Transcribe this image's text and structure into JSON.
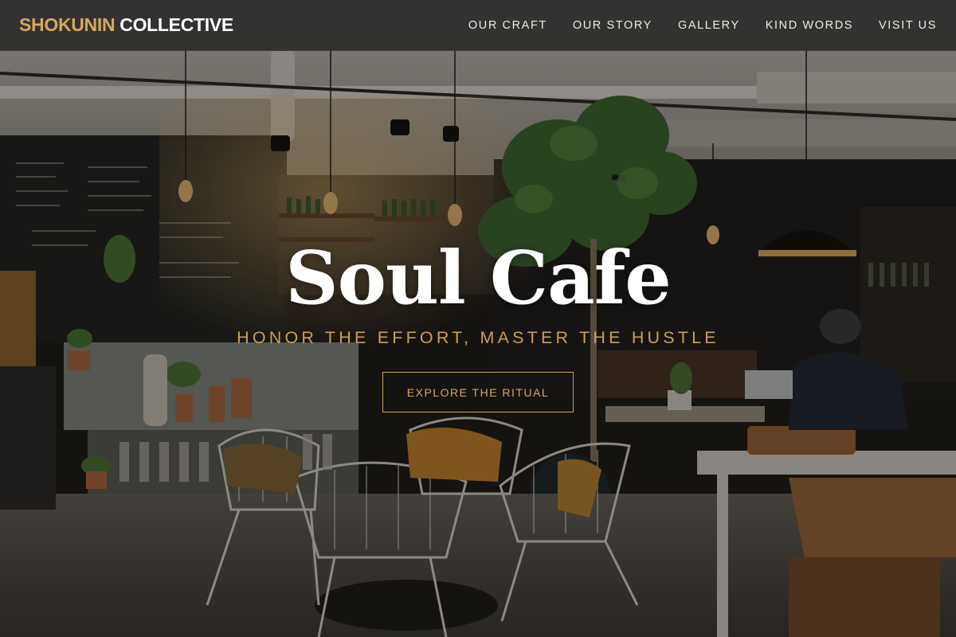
{
  "brand": {
    "part1": "SHOKUNIN",
    "part2": "COLLECTIVE"
  },
  "nav": {
    "items": [
      {
        "label": "OUR CRAFT"
      },
      {
        "label": "OUR STORY"
      },
      {
        "label": "GALLERY"
      },
      {
        "label": "KIND WORDS"
      },
      {
        "label": "VISIT US"
      }
    ]
  },
  "hero": {
    "title": "Soul Cafe",
    "tagline": "HONOR THE EFFORT, MASTER THE HUSTLE",
    "cta_label": "EXPLORE THE RITUAL",
    "background": "cafe-interior-photo"
  },
  "colors": {
    "accent_gold": "#d4a85f",
    "nav_bg": "#302f2d",
    "title_white": "#ffffff"
  }
}
